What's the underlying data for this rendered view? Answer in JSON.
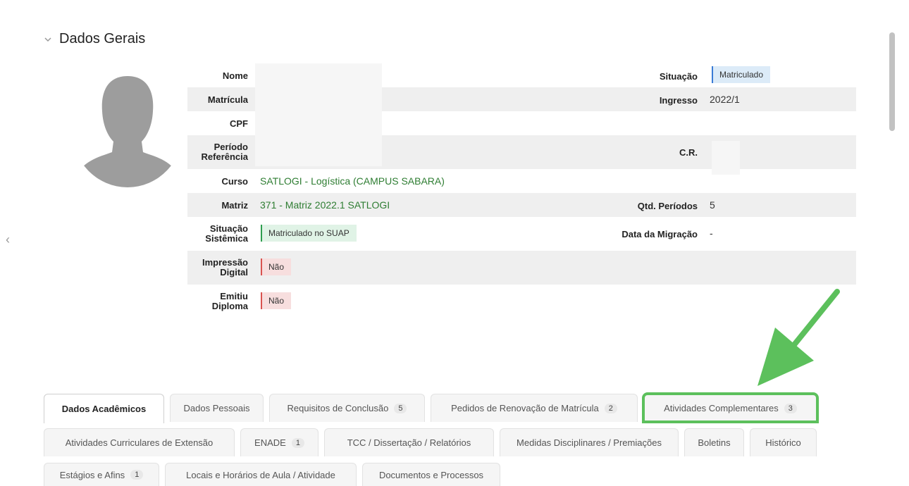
{
  "section": {
    "title": "Dados Gerais"
  },
  "fields": {
    "nome_label": "Nome",
    "matricula_label": "Matrícula",
    "cpf_label": "CPF",
    "periodo_label_1": "Período",
    "periodo_label_2": "Referência",
    "curso_label": "Curso",
    "curso_value": "SATLOGI - Logística (CAMPUS SABARA)",
    "matriz_label": "Matriz",
    "matriz_value": "371 - Matriz 2022.1 SATLOGI",
    "situacao_sist_label_1": "Situação",
    "situacao_sist_label_2": "Sistêmica",
    "situacao_sist_value": "Matriculado no SUAP",
    "impressao_label_1": "Impressão",
    "impressao_label_2": "Digital",
    "impressao_value": "Não",
    "emitiu_label_1": "Emitiu",
    "emitiu_label_2": "Diploma",
    "emitiu_value": "Não",
    "situacao_label": "Situação",
    "situacao_value": "Matriculado",
    "ingresso_label": "Ingresso",
    "ingresso_value": "2022/1",
    "cr_label": "C.R.",
    "qtd_label": "Qtd. Períodos",
    "qtd_value": "5",
    "migracao_label": "Data da Migração",
    "migracao_value": "-"
  },
  "tabs_row1": [
    {
      "label": "Dados Acadêmicos",
      "count": ""
    },
    {
      "label": "Dados Pessoais",
      "count": ""
    },
    {
      "label": "Requisitos de Conclusão",
      "count": "5"
    },
    {
      "label": "Pedidos de Renovação de Matrícula",
      "count": "2"
    },
    {
      "label": "Atividades Complementares",
      "count": "3"
    }
  ],
  "tabs_row2": [
    {
      "label": "Atividades Curriculares de Extensão",
      "count": ""
    },
    {
      "label": "ENADE",
      "count": "1"
    },
    {
      "label": "TCC / Dissertação / Relatórios",
      "count": ""
    },
    {
      "label": "Medidas Disciplinares / Premiações",
      "count": ""
    },
    {
      "label": "Boletins",
      "count": ""
    },
    {
      "label": "Histórico",
      "count": ""
    }
  ],
  "tabs_row3": [
    {
      "label": "Estágios e Afins",
      "count": "1"
    },
    {
      "label": "Locais e Horários de Aula / Atividade",
      "count": ""
    },
    {
      "label": "Documentos e Processos",
      "count": ""
    }
  ],
  "colors": {
    "highlight": "#5cc05c",
    "link": "#2e7d32"
  },
  "icons": {
    "collapse": "chevron-down-icon",
    "avatar": "user-silhouette-icon",
    "annotation": "arrow-annotation"
  }
}
